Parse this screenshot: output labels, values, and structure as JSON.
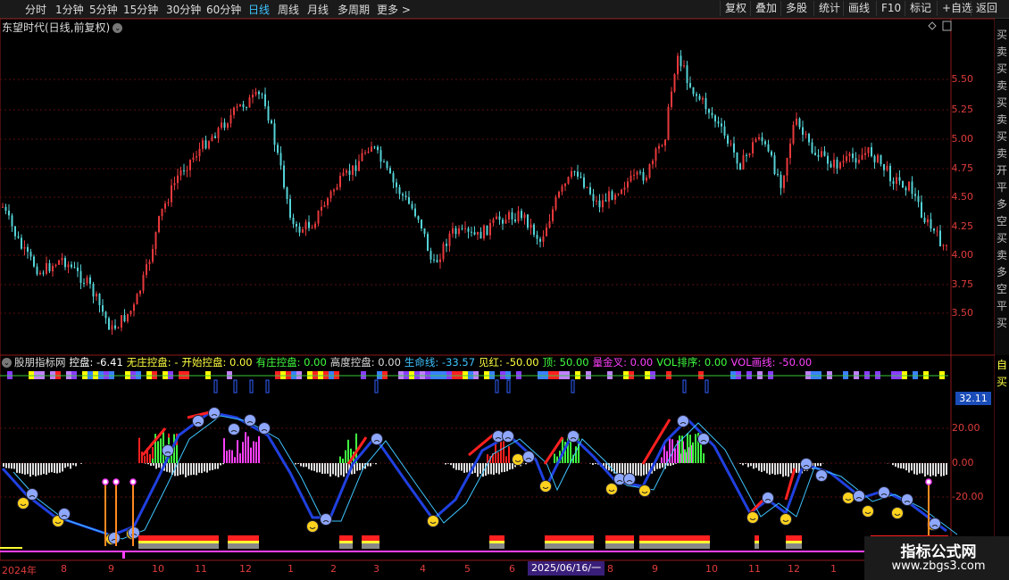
{
  "toolbar": {
    "periods": [
      "分时",
      "1分钟",
      "5分钟",
      "15分钟",
      "30分钟",
      "60分钟",
      "日线",
      "周线",
      "月线",
      "多周期",
      "更多 >"
    ],
    "active_period": "日线",
    "buttons": [
      "复权",
      "叠加",
      "多股",
      "统计",
      "画线",
      "F10",
      "标记",
      "+自选",
      "返回"
    ]
  },
  "chart_title": "东望时代(日线,前复权)",
  "price_axis": [
    "5.50",
    "5.25",
    "5.00",
    "4.75",
    "4.50",
    "4.25",
    "4.00",
    "3.75",
    "3.50"
  ],
  "indicator": {
    "name": "股朋指标网",
    "params": [
      {
        "label": "控盘:",
        "value": "-6.41",
        "color": "#ffffff"
      },
      {
        "label": "无庄控盘:",
        "value": "-",
        "color": "#ffff40"
      },
      {
        "label": "开始控盘:",
        "value": "0.00",
        "color": "#ffff40"
      },
      {
        "label": "有庄控盘:",
        "value": "0.00",
        "color": "#40ff40"
      },
      {
        "label": "高度控盘:",
        "value": "0.00",
        "color": "#dddddd"
      },
      {
        "label": "生命线:",
        "value": "-33.57",
        "color": "#3ec4ff"
      },
      {
        "label": "见红:",
        "value": "-50.00",
        "color": "#ffff40"
      },
      {
        "label": "顶:",
        "value": "50.00",
        "color": "#40ff40"
      },
      {
        "label": "量金叉:",
        "value": "0.00",
        "color": "#ff40ff"
      },
      {
        "label": "VOL排序:",
        "value": "0.00",
        "color": "#40ff40"
      },
      {
        "label": "VOL画线:",
        "value": "-50.00",
        "color": "#ff40ff"
      }
    ],
    "axis": [
      "20.00",
      "0.00",
      "-20.00"
    ],
    "current_value": "32.11"
  },
  "dates": [
    "2024年",
    "8",
    "9",
    "10",
    "11",
    "12",
    "1",
    "2",
    "3",
    "4",
    "5",
    "6",
    "7",
    "8",
    "9",
    "10",
    "11",
    "12",
    "1"
  ],
  "crosshair_date": "2025/06/16/一",
  "side_chars": [
    "买",
    "卖",
    "买",
    "卖",
    "买",
    "卖",
    "买",
    "卖",
    "开",
    "平",
    "多",
    "空",
    "买",
    "卖",
    "多",
    "空",
    "平",
    "买"
  ],
  "side_chars2": [
    "自",
    "买"
  ],
  "watermark": {
    "title": "指标公式网",
    "url": "www.zbgs3.com"
  }
}
